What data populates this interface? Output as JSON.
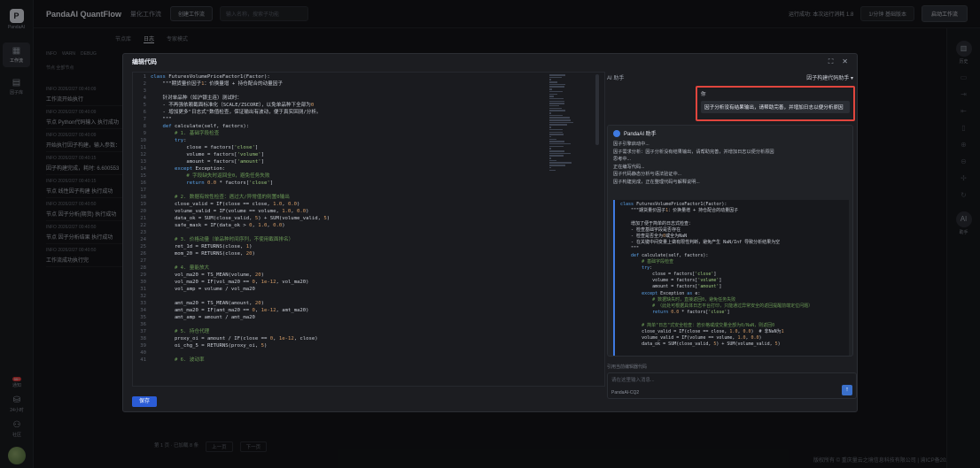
{
  "app": {
    "brand": "PandaAI QuantFlow",
    "brand_logo_text": "PandaAI",
    "crumb": "量化工作流",
    "create_btn": "创建工作流",
    "search_placeholder": "输入名称，搜索子功能"
  },
  "topbar_right": {
    "status": "运行成功: 本次运行消耗 1.8",
    "plan": "1/分钟 基础版本",
    "run_btn": "启动工作流"
  },
  "left_rail": [
    {
      "icon": "workflow-icon",
      "label": "工作流",
      "active": true
    },
    {
      "icon": "factor-icon",
      "label": "因子库"
    }
  ],
  "left_bottom": [
    {
      "label": "通知",
      "badge": "99+"
    },
    {
      "label": "24小时"
    },
    {
      "label": "社区"
    }
  ],
  "bg_tabs": [
    "节点库",
    "日志",
    "专家模式"
  ],
  "filters": [
    "INFO",
    "WARN",
    "DEBUG"
  ],
  "filter2": "节点 全部节点",
  "logs": [
    {
      "meta": "INFO 2026/2/27 00:40:09",
      "msg": "工作流开始执行"
    },
    {
      "meta": "INFO 2026/2/27 00:40:09",
      "msg": "节点 Python代码输入 执行成功"
    },
    {
      "meta": "INFO 2026/2/27 00:40:09",
      "msg": "开始执行因子构建，输入参数："
    },
    {
      "meta": "INFO 2026/2/27 00:40:15",
      "msg": "因子构建完成，耗时: 6.600553"
    },
    {
      "meta": "INFO 2026/2/27 00:40:15",
      "msg": "节点 线性因子构建 执行成功"
    },
    {
      "meta": "INFO 2026/2/27 00:40:50",
      "msg": "节点 因子分析(期货) 执行成功"
    },
    {
      "meta": "INFO 2026/2/27 00:40:50",
      "msg": "节点 因子分析结果 执行成功"
    },
    {
      "meta": "INFO 2026/2/27 00:40:50",
      "msg": "工作流成功执行完"
    }
  ],
  "pager": {
    "text": "第 1 页 · 已加载 8 条",
    "prev": "上一页",
    "next": "下一页"
  },
  "footer": "版权所有 © 重庆量云之境信息科技有限公司 | 渝ICP备2024048664号",
  "right_rail": [
    {
      "label": "历史"
    },
    {
      "label": "助手"
    }
  ],
  "modal": {
    "title": "编辑代码",
    "save": "保存",
    "code_lines": [
      {
        "n": "1",
        "t": "class FuturesVolumePriceFactor1(Factor):"
      },
      {
        "n": "2",
        "t": "    \"\"\"期货量价因子1：价换量增 + 持仓配合的动量因子"
      },
      {
        "n": "3",
        "t": ""
      },
      {
        "n": "4",
        "t": "    针对单品种（如沪银主连）测试时："
      },
      {
        "n": "5",
        "t": "    - 不再强依赖截面标准化（SCALE/ZSCORE），以免单品种下全部为0"
      },
      {
        "n": "6",
        "t": "    - 增加更多\"日志式\"数值检查，保证输出有波动，便于真实回测/分析。"
      },
      {
        "n": "7",
        "t": "    \"\"\""
      },
      {
        "n": "8",
        "t": "    def calculate(self, factors):"
      },
      {
        "n": "9",
        "t": "        # 1. 基础字段检查"
      },
      {
        "n": "10",
        "t": "        try:"
      },
      {
        "n": "11",
        "t": "            close = factors['close']"
      },
      {
        "n": "12",
        "t": "            volume = factors['volume']"
      },
      {
        "n": "13",
        "t": "            amount = factors['amount']"
      },
      {
        "n": "14",
        "t": "        except Exception:"
      },
      {
        "n": "15",
        "t": "            # 字段缺失时返回全0，避免任务失败"
      },
      {
        "n": "16",
        "t": "            return 0.0 * factors['close']"
      },
      {
        "n": "17",
        "t": ""
      },
      {
        "n": "18",
        "t": "        # 2. 数据有效性检查：遇过大/异常值的则置0输出"
      },
      {
        "n": "19",
        "t": "        close_valid = IF(close == close, 1.0, 0.0)"
      },
      {
        "n": "20",
        "t": "        volume_valid = IF(volume == volume, 1.0, 0.0)"
      },
      {
        "n": "21",
        "t": "        data_ok = SUM(close_valid, 5) + SUM(volume_valid, 5)"
      },
      {
        "n": "22",
        "t": "        safe_mask = IF(data_ok > 0, 1.0, 0.0)"
      },
      {
        "n": "23",
        "t": ""
      },
      {
        "n": "24",
        "t": "        # 3. 价格动量（单品种时间序列，不使用截面排名）"
      },
      {
        "n": "25",
        "t": "        ret_1d = RETURNS(close, 1)"
      },
      {
        "n": "26",
        "t": "        mom_20 = RETURNS(close, 20)"
      },
      {
        "n": "27",
        "t": ""
      },
      {
        "n": "28",
        "t": "        # 4. 量能放大"
      },
      {
        "n": "29",
        "t": "        vol_ma20 = TS_MEAN(volume, 20)"
      },
      {
        "n": "30",
        "t": "        vol_ma20 = IF(vol_ma20 == 0, 1e-12, vol_ma20)"
      },
      {
        "n": "31",
        "t": "        vol_amp = volume / vol_ma20"
      },
      {
        "n": "32",
        "t": ""
      },
      {
        "n": "33",
        "t": "        amt_ma20 = TS_MEAN(amount, 20)"
      },
      {
        "n": "34",
        "t": "        amt_ma20 = IF(amt_ma20 == 0, 1e-12, amt_ma20)"
      },
      {
        "n": "35",
        "t": "        amt_amp = amount / amt_ma20"
      },
      {
        "n": "36",
        "t": ""
      },
      {
        "n": "37",
        "t": "        # 5. 持仓代理"
      },
      {
        "n": "38",
        "t": "        proxy_oi = amount / IF(close == 0, 1e-12, close)"
      },
      {
        "n": "39",
        "t": "        oi_chg_5 = RETURNS(proxy_oi, 5)"
      },
      {
        "n": "40",
        "t": ""
      },
      {
        "n": "41",
        "t": "        # 6. 波动率"
      }
    ]
  },
  "assistant": {
    "label": "AI 助手",
    "picker": "因子构建代码助手",
    "user_label": "你",
    "user_msg": "因子分析没有结果输出，请帮助完善，并增加日志以便分析原因",
    "ai_name": "PandaAI 助手",
    "status_lines": [
      "因子引擎启动中...",
      "因子需求分析：因子分析没有结果输出，请帮助完善，并增加日志以便分析原因",
      "思考中...",
      "正在编写代码...",
      "因子代码静态分析与语法验证中...",
      "因子构建完成，正在整理代码与解释说明..."
    ],
    "code_lines": [
      "class FuturesVolumePriceFactor1(Factor):",
      "    \"\"\"期货量价因子1：价换量增 + 持仓配合的动量因子",
      "",
      "    增加了便于简单的日志式检查：",
      "    - 检查基础字段是否存在",
      "    - 检查是否全为0或全为NaN",
      "    - 在关键中间变量上做有限性判断，避免产生 NaN/Inf 导致分析结果为空",
      "    \"\"\"",
      "    def calculate(self, factors):",
      "        # 基础字段检查",
      "        try:",
      "            close = factors['close']",
      "            volume = factors['volume']",
      "            amount = factors['amount']",
      "        except Exception as e:",
      "            # 数据缺失时，直接返回0，避免任务失败",
      "            # （此处可根据具体日志平台打印，只能通过异常安全的返回提醒前端定位问题）",
      "            return 0.0 * factors['close']",
      "",
      "        # 简单\"日志\"式安全检查：若价格或成交量全部为0/NaN，则返回0",
      "        close_valid = IF(close == close, 1.0, 0.0)  # 非NaN为1",
      "        volume_valid = IF(volume == volume, 1.0, 0.0)",
      "        data_ok = SUM(close_valid, 5) + SUM(volume_valid, 5)"
    ],
    "ctx": "引用当前编辑器代码",
    "input_placeholder": "请在这里输入消息...",
    "model": "PandaAI-CQ2"
  }
}
